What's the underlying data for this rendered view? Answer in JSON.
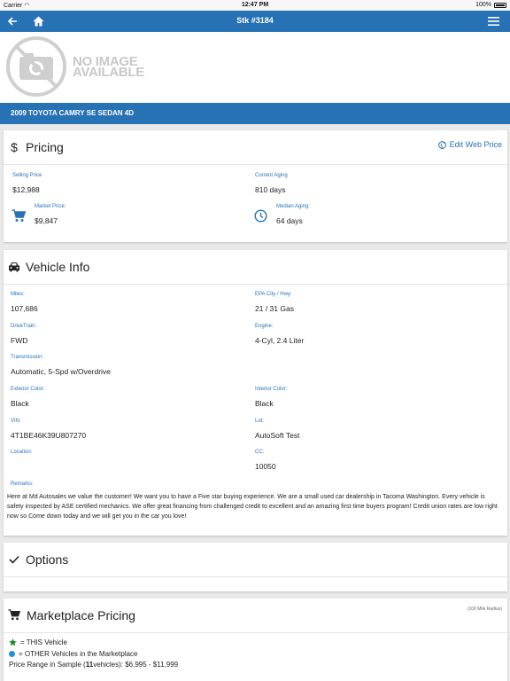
{
  "status_bar": {
    "carrier": "Carrier",
    "time": "12:47 PM",
    "battery": "100%"
  },
  "nav": {
    "title": "Stk #3184",
    "icons": [
      "back-arrow-icon",
      "home-icon",
      "hamburger-menu-icon"
    ]
  },
  "photo": {
    "placeholder_line1": "NO IMAGE",
    "placeholder_line2": "AVAILABLE"
  },
  "vehicle": {
    "title": "2009 TOYOTA CAMRY SE SEDAN 4D"
  },
  "pricing": {
    "title": "Pricing",
    "edit_link": "Edit Web Price",
    "selling_price_label": "Selling Price",
    "selling_price": "$12,988",
    "current_aging_label": "Current Aging",
    "current_aging": "810 days",
    "market_price_label": "Market Price:",
    "market_price": "$9,847",
    "median_aging_label": "Median Aging:",
    "median_aging": "64 days"
  },
  "vehicle_info": {
    "title": "Vehicle Info",
    "miles_label": "Miles:",
    "miles": "107,686",
    "epa_label": "EPA City / Hwy:",
    "epa": "21 / 31 Gas",
    "drivetrain_label": "DriveTrain:",
    "drivetrain": "FWD",
    "engine_label": "Engine:",
    "engine": "4-Cyl, 2.4 Liter",
    "transmission_label": "Transmission:",
    "transmission": "Automatic, 5-Spd w/Overdrive",
    "exterior_label": "Exterior Color:",
    "exterior": "Black",
    "interior_label": "Interior Color:",
    "interior": "Black",
    "vin_label": "VIN:",
    "vin": "4T1BE46K39U807270",
    "lot_label": "Lot:",
    "lot": "AutoSoft Test",
    "location_label": "Location:",
    "location": "",
    "cc_label": "CC:",
    "cc": "10050",
    "remarks_label": "Remarks:",
    "remarks": "Here at Md Autosales we value the customer! We want you to have a Five star buying experience. We are a small used car dealership in Tacoma Washington. Every vehicle is safety inspected by ASE certified mechanics. We offer great financing from challenged credit to excellent and an amazing first time buyers program! Credit union rates are low right now so Come down today and we will get you in the car you love!"
  },
  "options": {
    "title": "Options"
  },
  "marketplace": {
    "title": "Marketplace Pricing",
    "radius": "(100 Mile Radius)",
    "legend_this": "= THIS Vehicle",
    "legend_other": "= OTHER Vehicles in the Marketplace",
    "range_prefix": "Price Range in Sample (",
    "range_count": "11",
    "range_suffix": " vehicles): $6,995 - $11,999"
  },
  "colors": {
    "brand_blue": "#2772b4",
    "star_green": "#1a8a2a",
    "dot_blue": "#1e90e0"
  }
}
